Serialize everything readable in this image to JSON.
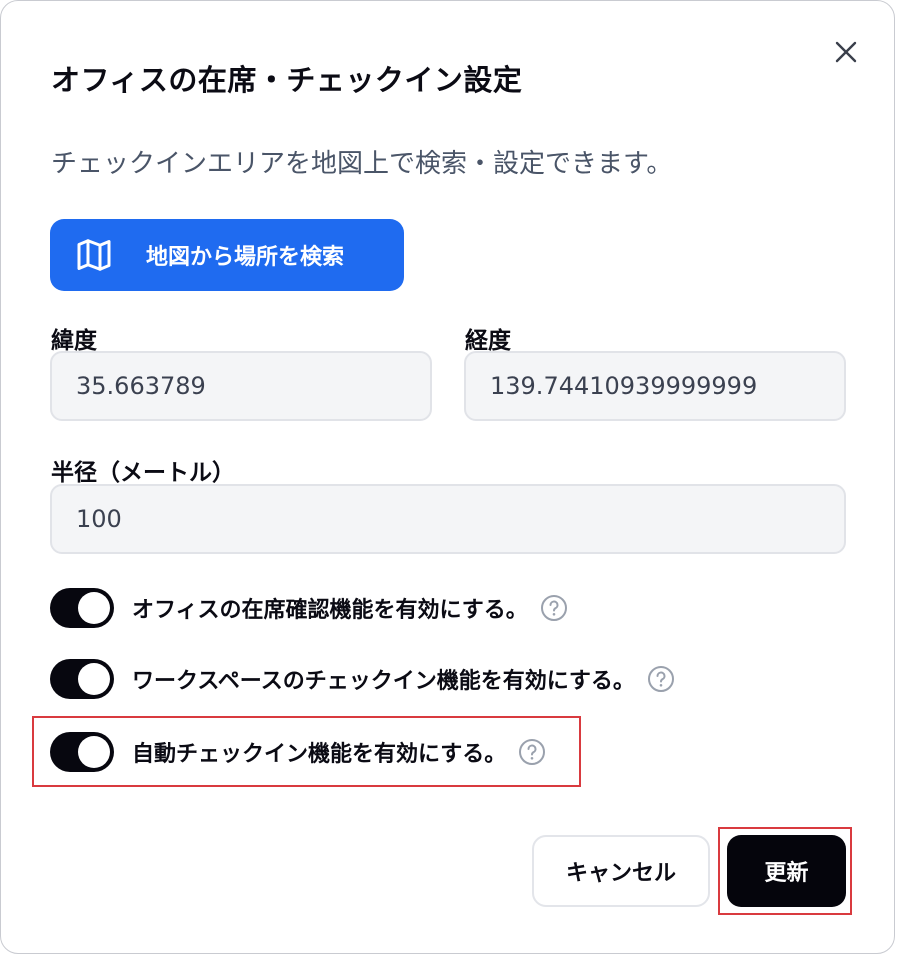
{
  "dialog": {
    "title": "オフィスの在席・チェックイン設定",
    "description": "チェックインエリアを地図上で検索・設定できます。",
    "close_icon": "close-icon"
  },
  "map_search": {
    "label": "地図から場所を検索",
    "icon": "map-icon"
  },
  "fields": {
    "latitude": {
      "label": "緯度",
      "value": "35.663789"
    },
    "longitude": {
      "label": "経度",
      "value": "139.74410939999999"
    },
    "radius": {
      "label": "半径（メートル）",
      "value": "100"
    }
  },
  "toggles": [
    {
      "label": "オフィスの在席確認機能を有効にする。",
      "enabled": true,
      "help_icon": "question-circle-icon"
    },
    {
      "label": "ワークスペースのチェックイン機能を有効にする。",
      "enabled": true,
      "help_icon": "question-circle-icon"
    },
    {
      "label": "自動チェックイン機能を有効にする。",
      "enabled": true,
      "help_icon": "question-circle-icon"
    }
  ],
  "buttons": {
    "cancel_label": "キャンセル",
    "update_label": "更新"
  },
  "colors": {
    "primary_blue": "#1f6bf0",
    "toggle_on": "#07070f",
    "update_button": "#05050c",
    "highlight": "#d93a3f"
  }
}
